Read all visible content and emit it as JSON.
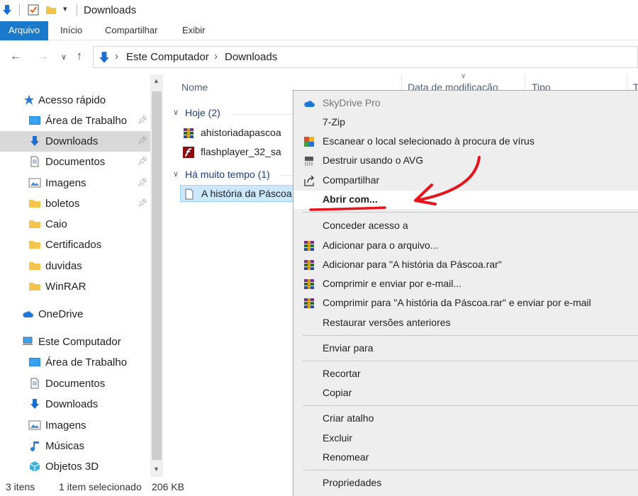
{
  "window": {
    "title": "Downloads"
  },
  "ribbon": {
    "tabs": [
      "Arquivo",
      "Início",
      "Compartilhar",
      "Exibir"
    ]
  },
  "address": {
    "crumbs": [
      "Este Computador",
      "Downloads"
    ]
  },
  "sidebar": {
    "items": [
      {
        "label": "Acesso rápido",
        "icon": "star-icon"
      },
      {
        "label": "Área de Trabalho",
        "icon": "desktop-icon"
      },
      {
        "label": "Downloads",
        "icon": "download-arrow-icon"
      },
      {
        "label": "Documentos",
        "icon": "document-icon"
      },
      {
        "label": "Imagens",
        "icon": "picture-icon"
      },
      {
        "label": "boletos",
        "icon": "folder-icon"
      },
      {
        "label": "Caio",
        "icon": "folder-icon"
      },
      {
        "label": "Certificados",
        "icon": "folder-icon"
      },
      {
        "label": "duvidas",
        "icon": "folder-icon"
      },
      {
        "label": "WinRAR",
        "icon": "folder-icon"
      },
      {
        "label": "OneDrive",
        "icon": "cloud-icon"
      },
      {
        "label": "Este Computador",
        "icon": "computer-icon"
      },
      {
        "label": "Área de Trabalho",
        "icon": "desktop-icon"
      },
      {
        "label": "Documentos",
        "icon": "document-icon"
      },
      {
        "label": "Downloads",
        "icon": "download-arrow-icon"
      },
      {
        "label": "Imagens",
        "icon": "picture-icon"
      },
      {
        "label": "Músicas",
        "icon": "music-note-icon"
      },
      {
        "label": "Objetos 3D",
        "icon": "cube-icon"
      }
    ]
  },
  "columns": {
    "name": "Nome",
    "date": "Data de modificação",
    "type": "Tipo",
    "size": "T"
  },
  "groups": [
    {
      "label": "Hoje (2)",
      "files": [
        "ahistoriadapascoa",
        "flashplayer_32_sa"
      ]
    },
    {
      "label": "Há muito tempo (1)",
      "files": [
        "A história da Páscoa"
      ]
    }
  ],
  "status": {
    "count": "3 itens",
    "selection": "1 item selecionado",
    "size": "206 KB"
  },
  "context_menu": {
    "items": [
      "SkyDrive Pro",
      "7-Zip",
      "Escanear o local selecionado à procura de vírus",
      "Destruir usando o AVG",
      "Compartilhar",
      "Abrir com...",
      "Conceder acesso a",
      "Adicionar para o arquivo...",
      "Adicionar para \"A história da Páscoa.rar\"",
      "Comprimir e enviar por e-mail...",
      "Comprimir para \"A história da Páscoa.rar\" e enviar por e-mail",
      "Restaurar versões anteriores",
      "Enviar para",
      "Recortar",
      "Copiar",
      "Criar atalho",
      "Excluir",
      "Renomear",
      "Propriedades"
    ]
  },
  "colors": {
    "accent": "#1979ca",
    "annotation": "#e8141b",
    "selection": "#cce8ff",
    "group_text": "#1e3d78"
  }
}
